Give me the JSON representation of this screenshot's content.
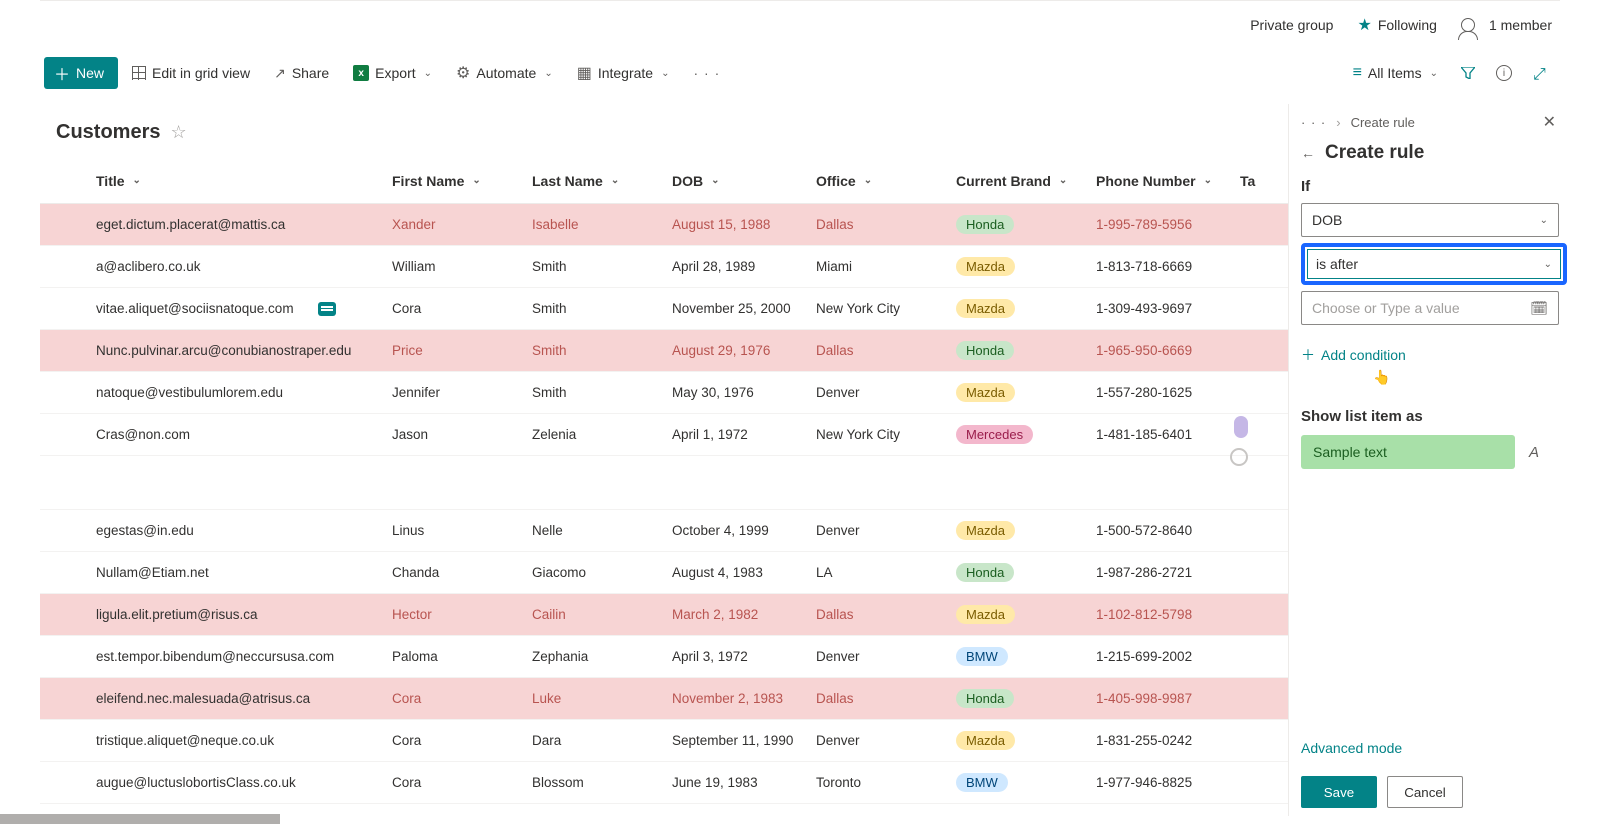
{
  "header": {
    "private_group": "Private group",
    "following": "Following",
    "members": "1 member"
  },
  "toolbar": {
    "new": "New",
    "edit_grid": "Edit in grid view",
    "share": "Share",
    "export": "Export",
    "automate": "Automate",
    "integrate": "Integrate",
    "all_items": "All Items"
  },
  "list": {
    "title": "Customers"
  },
  "columns": {
    "title": "Title",
    "first": "First Name",
    "last": "Last Name",
    "dob": "DOB",
    "office": "Office",
    "brand": "Current Brand",
    "phone": "Phone Number",
    "ta": "Ta"
  },
  "rows": [
    {
      "hl": true,
      "title": "eget.dictum.placerat@mattis.ca",
      "first": "Xander",
      "last": "Isabelle",
      "dob": "August 15, 1988",
      "office": "Dallas",
      "brand": "Honda",
      "bclass": "honda",
      "phone": "1-995-789-5956",
      "comment": false
    },
    {
      "hl": false,
      "title": "a@aclibero.co.uk",
      "first": "William",
      "last": "Smith",
      "dob": "April 28, 1989",
      "office": "Miami",
      "brand": "Mazda",
      "bclass": "mazda",
      "phone": "1-813-718-6669",
      "comment": false
    },
    {
      "hl": false,
      "title": "vitae.aliquet@sociisnatoque.com",
      "first": "Cora",
      "last": "Smith",
      "dob": "November 25, 2000",
      "office": "New York City",
      "brand": "Mazda",
      "bclass": "mazda",
      "phone": "1-309-493-9697",
      "comment": true
    },
    {
      "hl": true,
      "title": "Nunc.pulvinar.arcu@conubianostraper.edu",
      "first": "Price",
      "last": "Smith",
      "dob": "August 29, 1976",
      "office": "Dallas",
      "brand": "Honda",
      "bclass": "honda",
      "phone": "1-965-950-6669",
      "comment": false
    },
    {
      "hl": false,
      "title": "natoque@vestibulumlorem.edu",
      "first": "Jennifer",
      "last": "Smith",
      "dob": "May 30, 1976",
      "office": "Denver",
      "brand": "Mazda",
      "bclass": "mazda",
      "phone": "1-557-280-1625",
      "comment": false
    },
    {
      "hl": false,
      "title": "Cras@non.com",
      "first": "Jason",
      "last": "Zelenia",
      "dob": "April 1, 1972",
      "office": "New York City",
      "brand": "Mercedes",
      "bclass": "mercedes",
      "phone": "1-481-185-6401",
      "comment": false
    }
  ],
  "rows2": [
    {
      "hl": false,
      "title": "egestas@in.edu",
      "first": "Linus",
      "last": "Nelle",
      "dob": "October 4, 1999",
      "office": "Denver",
      "brand": "Mazda",
      "bclass": "mazda",
      "phone": "1-500-572-8640"
    },
    {
      "hl": false,
      "title": "Nullam@Etiam.net",
      "first": "Chanda",
      "last": "Giacomo",
      "dob": "August 4, 1983",
      "office": "LA",
      "brand": "Honda",
      "bclass": "honda",
      "phone": "1-987-286-2721"
    },
    {
      "hl": true,
      "title": "ligula.elit.pretium@risus.ca",
      "first": "Hector",
      "last": "Cailin",
      "dob": "March 2, 1982",
      "office": "Dallas",
      "brand": "Mazda",
      "bclass": "mazda",
      "phone": "1-102-812-5798"
    },
    {
      "hl": false,
      "title": "est.tempor.bibendum@neccursusa.com",
      "first": "Paloma",
      "last": "Zephania",
      "dob": "April 3, 1972",
      "office": "Denver",
      "brand": "BMW",
      "bclass": "bmw",
      "phone": "1-215-699-2002"
    },
    {
      "hl": true,
      "title": "eleifend.nec.malesuada@atrisus.ca",
      "first": "Cora",
      "last": "Luke",
      "dob": "November 2, 1983",
      "office": "Dallas",
      "brand": "Honda",
      "bclass": "honda",
      "phone": "1-405-998-9987"
    },
    {
      "hl": false,
      "title": "tristique.aliquet@neque.co.uk",
      "first": "Cora",
      "last": "Dara",
      "dob": "September 11, 1990",
      "office": "Denver",
      "brand": "Mazda",
      "bclass": "mazda",
      "phone": "1-831-255-0242"
    },
    {
      "hl": false,
      "title": "augue@luctuslobortisClass.co.uk",
      "first": "Cora",
      "last": "Blossom",
      "dob": "June 19, 1983",
      "office": "Toronto",
      "brand": "BMW",
      "bclass": "bmw",
      "phone": "1-977-946-8825"
    }
  ],
  "panel": {
    "crumb": "Create rule",
    "title": "Create rule",
    "if_label": "If",
    "field": "DOB",
    "operator": "is after",
    "value_placeholder": "Choose or Type a value",
    "add_condition": "Add condition",
    "show_label": "Show list item as",
    "sample": "Sample text",
    "advanced": "Advanced mode",
    "save": "Save",
    "cancel": "Cancel"
  }
}
